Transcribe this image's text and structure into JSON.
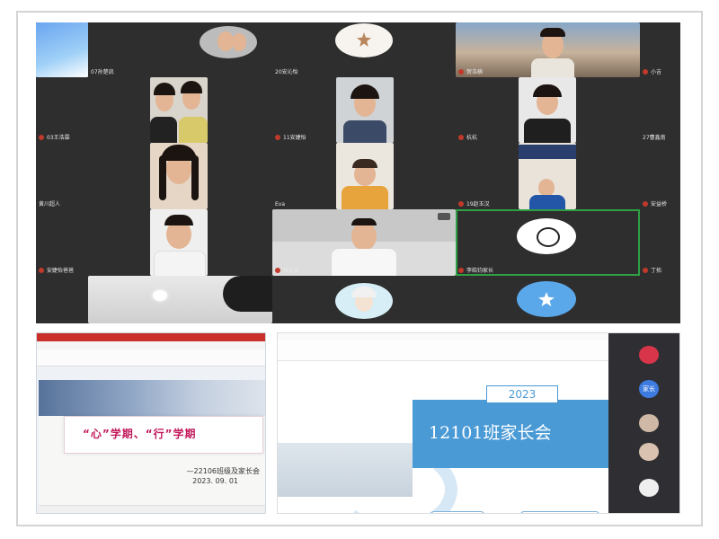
{
  "grid": {
    "tiles": [
      {
        "name": "07孙楚凯",
        "speaking": false
      },
      {
        "name": "20安沁怡",
        "speaking": false
      },
      {
        "name": "贺浩楠",
        "speaking": false
      },
      {
        "name": "小吉",
        "speaking": false
      },
      {
        "name": "03王浩霖",
        "speaking": false
      },
      {
        "name": "11安婕怡",
        "speaking": false
      },
      {
        "name": "杭杭",
        "speaking": false
      },
      {
        "name": "27曹鑫南",
        "speaking": false
      },
      {
        "name": "黄川超人",
        "speaking": false
      },
      {
        "name": "Eva",
        "speaking": false
      },
      {
        "name": "19赵玉汉",
        "speaking": false
      },
      {
        "name": "安益桥",
        "speaking": false
      },
      {
        "name": "安婕怡爸爸",
        "speaking": false
      },
      {
        "name": "张文发",
        "speaking": false
      },
      {
        "name": "李皓钧家长",
        "speaking": true
      },
      {
        "name": "丁拓",
        "speaking": false
      }
    ],
    "colors": {
      "speaking_border": "#2ea043",
      "tile_bg": "#2e2e2e"
    }
  },
  "ppt_left": {
    "slide_title": "“心”学期、“行”学期",
    "subtitle": "—22106班级及家长会",
    "date": "2023. 09. 01",
    "accent": "#c2185b"
  },
  "ppt_right": {
    "year": "2023",
    "title": "12101班家长会",
    "participants": [
      {
        "label": "家长"
      }
    ],
    "accent": "#4a9ad6"
  }
}
